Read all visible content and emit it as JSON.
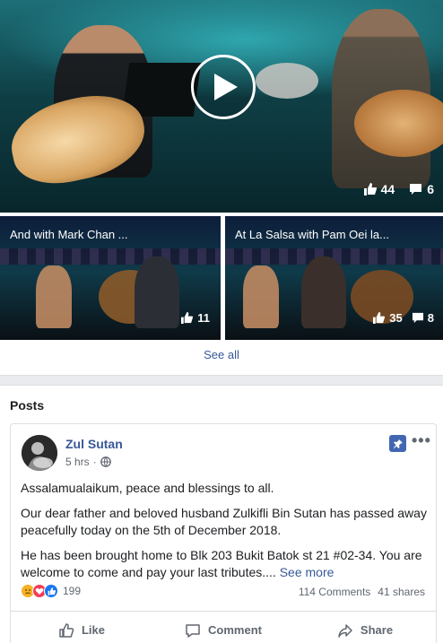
{
  "video": {
    "likes": "44",
    "comments": "6"
  },
  "thumbnails": [
    {
      "title": "And with Mark Chan ...",
      "likes": "11",
      "comments": ""
    },
    {
      "title": "At La Salsa with Pam Oei la...",
      "likes": "35",
      "comments": "8"
    }
  ],
  "see_all": "See all",
  "posts_heading": "Posts",
  "post": {
    "author": "Zul Sutan",
    "time": "5 hrs",
    "paragraphs": [
      "Assalamualaikum, peace and blessings to all.",
      "Our dear father and beloved husband Zulkifli Bin Sutan has passed away peacefully today on the 5th of December 2018.",
      "He has been brought home to Blk 203 Bukit Batok st 21 #02-34. You are welcome to come and pay your last tributes...."
    ],
    "see_more": "See more",
    "reaction_count": "199",
    "comments_count": "114 Comments",
    "shares_count": "41 shares",
    "actions": {
      "like": "Like",
      "comment": "Comment",
      "share": "Share"
    }
  },
  "colors": {
    "link": "#385898",
    "accent": "#4267b2",
    "separator": "#e9ebee"
  }
}
